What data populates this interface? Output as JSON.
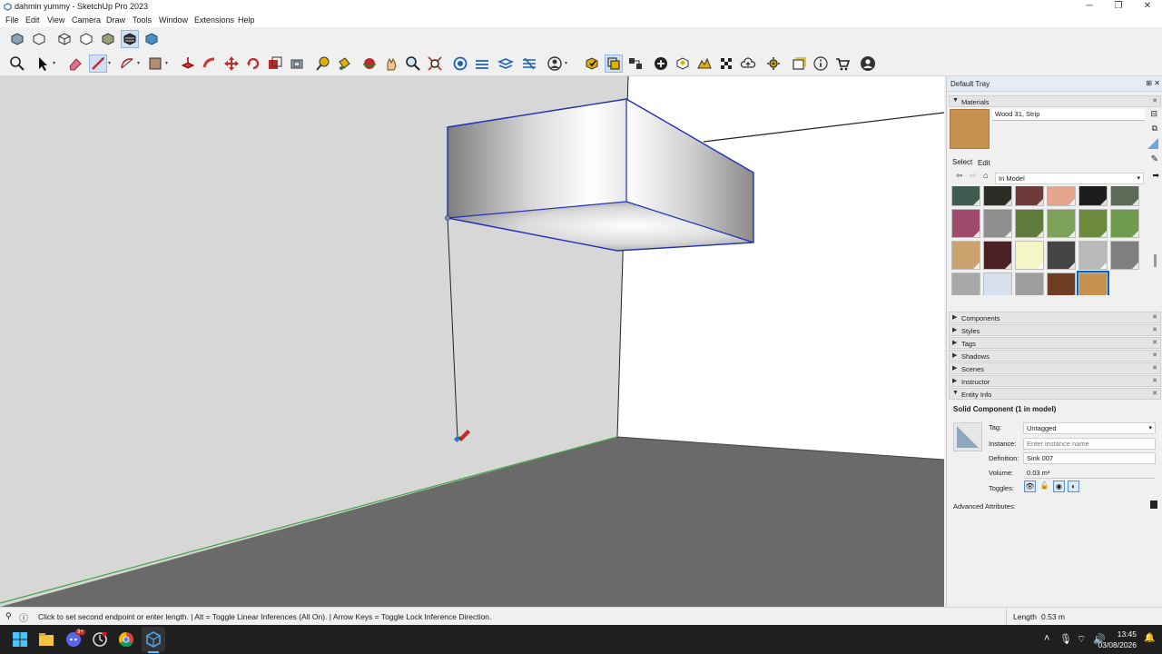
{
  "window": {
    "title": "dahmin yummy - SketchUp Pro 2023"
  },
  "menu": [
    "File",
    "Edit",
    "View",
    "Camera",
    "Draw",
    "Tools",
    "Window",
    "Extensions",
    "Help"
  ],
  "tray": {
    "title": "Default Tray",
    "materials": {
      "section_label": "Materials",
      "current_material": "Wood 31, Strip",
      "tab_select": "Select",
      "tab_edit": "Edit",
      "library": "In Model",
      "swatches": [
        {
          "color": "#3f5a4f"
        },
        {
          "color": "#2c2c24"
        },
        {
          "color": "#6e3a3a"
        },
        {
          "color": "#e3a58c"
        },
        {
          "color": "#1d1d1d"
        },
        {
          "color": "#5c6b58"
        },
        {
          "color": "#a04a6e"
        },
        {
          "color": "#8f8f8f"
        },
        {
          "color": "#5f7b3c"
        },
        {
          "color": "#7fa25a"
        },
        {
          "color": "#6b8a3e"
        },
        {
          "color": "#6e9b4c"
        },
        {
          "color": "#caa36f"
        },
        {
          "color": "#4a2024"
        },
        {
          "color": "#f4f6c6"
        },
        {
          "color": "#444444"
        },
        {
          "color": "#b9b9b9"
        },
        {
          "color": "#7f7f7f"
        },
        {
          "color": "#a9a9a9"
        },
        {
          "color": "#d7e0ee"
        },
        {
          "color": "#9e9e9e"
        },
        {
          "color": "#6e3d22"
        },
        {
          "color": "#c6914f"
        }
      ]
    },
    "sections": [
      "Components",
      "Styles",
      "Tags",
      "Shadows",
      "Scenes",
      "Instructor"
    ],
    "entity_info": {
      "section_label": "Entity Info",
      "heading": "Solid Component (1 in model)",
      "tag_label": "Tag:",
      "tag_value": "Untagged",
      "instance_label": "Instance:",
      "instance_placeholder": "Enter instance name",
      "definition_label": "Definition:",
      "definition_value": "Sink 007",
      "volume_label": "Volume:",
      "volume_value": "0.03 m³",
      "toggles_label": "Toggles:",
      "advanced_label": "Advanced Attributes:"
    }
  },
  "status": {
    "message": "Click to set second endpoint or enter length. | Alt = Toggle Linear Inferences (All On). | Arrow Keys = Toggle Lock Inference Direction.",
    "measure_label": "Length",
    "measure_value": "0.53 m"
  },
  "taskbar": {
    "time": "13:45",
    "date": "03/08/2026",
    "discord_badge": "9+"
  },
  "colors": {
    "selection": "#1f2fb8",
    "wall_shade": "#d7d7d7",
    "floor": "#6a6a6a",
    "green_axis": "#3fa53f",
    "accent": "#0a64c8"
  }
}
